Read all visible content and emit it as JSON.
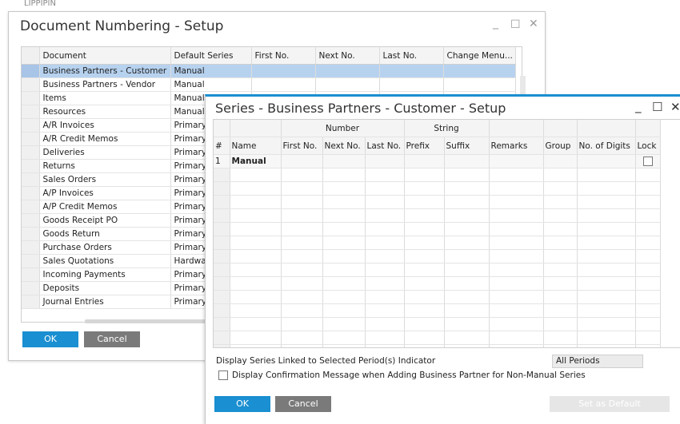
{
  "background": {
    "peek_text": "LIPPIPIN"
  },
  "doc_window": {
    "title": "Document Numbering - Setup",
    "controls": {
      "minimize": "_",
      "maximize": "☐",
      "close": "✕"
    },
    "columns": [
      "Document",
      "Default Series",
      "First No.",
      "Next No.",
      "Last No.",
      "Change Menu..."
    ],
    "rows": [
      {
        "document": "Business Partners - Customer",
        "series": "Manual"
      },
      {
        "document": "Business Partners - Vendor",
        "series": "Manual"
      },
      {
        "document": "Items",
        "series": "Manual"
      },
      {
        "document": "Resources",
        "series": "Manual"
      },
      {
        "document": "A/R Invoices",
        "series": "Primary"
      },
      {
        "document": "A/R Credit Memos",
        "series": "Primary"
      },
      {
        "document": "Deliveries",
        "series": "Primary"
      },
      {
        "document": "Returns",
        "series": "Primary"
      },
      {
        "document": "Sales Orders",
        "series": "Primary"
      },
      {
        "document": "A/P Invoices",
        "series": "Primary"
      },
      {
        "document": "A/P Credit Memos",
        "series": "Primary"
      },
      {
        "document": "Goods Receipt PO",
        "series": "Primary"
      },
      {
        "document": "Goods Return",
        "series": "Primary"
      },
      {
        "document": "Purchase Orders",
        "series": "Primary"
      },
      {
        "document": "Sales Quotations",
        "series": "Hardwa"
      },
      {
        "document": "Incoming Payments",
        "series": "Primary"
      },
      {
        "document": "Deposits",
        "series": "Primary"
      },
      {
        "document": "Journal Entries",
        "series": "Primary"
      }
    ],
    "ok_label": "OK",
    "cancel_label": "Cancel",
    "accent": "#1a8fd1",
    "selected_row_color": "#b7d2ef"
  },
  "series_window": {
    "title": "Series - Business Partners - Customer - Setup",
    "controls": {
      "minimize": "_",
      "maximize": "☐",
      "close": "✕"
    },
    "group_headers": {
      "number": "Number",
      "string": "String"
    },
    "columns": [
      "#",
      "Name",
      "First No.",
      "Next No.",
      "Last No.",
      "Prefix",
      "Suffix",
      "Remarks",
      "Group",
      "No. of Digits",
      "Lock"
    ],
    "rows": [
      {
        "num": "1",
        "name": "Manual",
        "lock": false
      }
    ],
    "linked_period_label": "Display Series Linked to Selected Period(s) Indicator",
    "period_value": "All Periods",
    "confirmation_label": "Display Confirmation Message when Adding Business Partner for Non-Manual Series",
    "confirmation_checked": false,
    "ok_label": "OK",
    "cancel_label": "Cancel",
    "set_default_label": "Set as Default"
  }
}
